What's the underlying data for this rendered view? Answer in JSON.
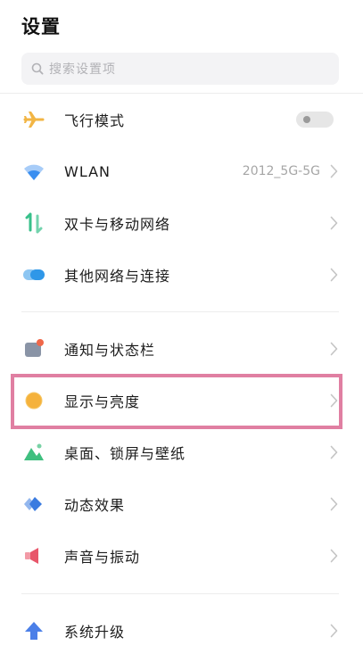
{
  "header": {
    "title": "设置"
  },
  "search": {
    "placeholder": "搜索设置项"
  },
  "items": [
    {
      "id": "airplane",
      "label": "飞行模式",
      "icon": "airplane-icon",
      "control": "toggle",
      "toggle_on": false
    },
    {
      "id": "wlan",
      "label": "WLAN",
      "icon": "wifi-icon",
      "value": "2012_5G-5G",
      "control": "chevron"
    },
    {
      "id": "dual-sim",
      "label": "双卡与移动网络",
      "icon": "dual-sim-icon",
      "control": "chevron"
    },
    {
      "id": "other-networks",
      "label": "其他网络与连接",
      "icon": "other-networks-icon",
      "control": "chevron"
    },
    {
      "id": "notifications",
      "label": "通知与状态栏",
      "icon": "notification-icon",
      "control": "chevron"
    },
    {
      "id": "display",
      "label": "显示与亮度",
      "icon": "brightness-icon",
      "control": "chevron",
      "highlighted": true
    },
    {
      "id": "wallpaper",
      "label": "桌面、锁屏与壁纸",
      "icon": "wallpaper-icon",
      "control": "chevron"
    },
    {
      "id": "animations",
      "label": "动态效果",
      "icon": "animation-icon",
      "control": "chevron"
    },
    {
      "id": "sound",
      "label": "声音与振动",
      "icon": "speaker-icon",
      "control": "chevron"
    },
    {
      "id": "system-update",
      "label": "系统升级",
      "icon": "upgrade-arrow-icon",
      "control": "chevron"
    }
  ],
  "colors": {
    "highlight_border": "#e07fa2",
    "airplane_icon": "#f2b544",
    "wifi_icon": "#3b8ff0",
    "dual_sim_icon": "#37c08a",
    "other_networks_icon": "#2f97e8",
    "notification_icon": "#8a94a6",
    "notification_dot": "#f0684a",
    "brightness_icon": "#f5b23c",
    "wallpaper_icon": "#3fbf7f",
    "animation_icon": "#3a7be0",
    "speaker_icon": "#e8566a",
    "upgrade_icon": "#4b7fe8"
  }
}
